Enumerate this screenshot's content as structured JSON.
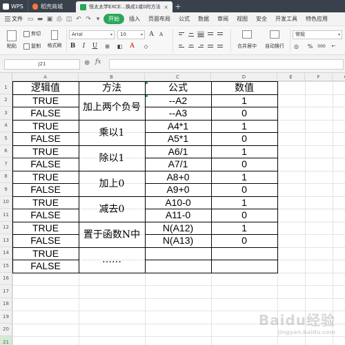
{
  "titlebar": {
    "app_name": "WPS",
    "store_tab": "稻壳商城",
    "doc_tab": "怪太太学EXCE...换成1或0的方法",
    "close": "×",
    "new_tab": "+"
  },
  "menubar": {
    "file_label": "文件",
    "items": [
      "开始",
      "插入",
      "页面布局",
      "公式",
      "数据",
      "审阅",
      "视图",
      "安全",
      "开发工具",
      "特色应用"
    ],
    "active_index": 0
  },
  "ribbon": {
    "paste": "粘贴",
    "cut": "剪切",
    "copy": "复制",
    "format_painter": "格式刷",
    "font_name": "Arial",
    "font_size": "10",
    "merge_center": "合并居中",
    "wrap": "自动换行",
    "number_format": "常规",
    "percent": "%",
    "thousands": "000",
    "bold": "B",
    "italic": "I",
    "underline": "U",
    "font_color": "A"
  },
  "formula_bar": {
    "name_box": "J21",
    "fx": "fx",
    "formula": ""
  },
  "grid": {
    "columns": [
      "A",
      "B",
      "C",
      "D",
      "E",
      "F",
      "G"
    ],
    "rows": [
      "1",
      "2",
      "3",
      "4",
      "5",
      "6",
      "7",
      "8",
      "9",
      "10",
      "11",
      "12",
      "13",
      "14",
      "15",
      "16",
      "17",
      "18",
      "19",
      "20",
      "21"
    ],
    "active_row": "21"
  },
  "table": {
    "headers": [
      "逻辑值",
      "方法",
      "公式",
      "数值"
    ],
    "logic_values": [
      "TRUE",
      "FALSE",
      "TRUE",
      "FALSE",
      "TRUE",
      "FALSE",
      "TRUE",
      "FALSE",
      "TRUE",
      "FALSE",
      "TRUE",
      "FALSE",
      "TRUE",
      "FALSE"
    ],
    "methods": [
      "加上两个负号",
      "乘以1",
      "除以1",
      "加上0",
      "减去0",
      "置于函数N中",
      "……"
    ],
    "formulas": [
      "--A2",
      "--A3",
      "A4*1",
      "A5*1",
      "A6/1",
      "A7/1",
      "A8+0",
      "A9+0",
      "A10-0",
      "A11-0",
      "N(A12)",
      "N(A13)",
      "",
      ""
    ],
    "results": [
      "1",
      "0",
      "1",
      "0",
      "1",
      "0",
      "1",
      "0",
      "1",
      "0",
      "1",
      "0",
      "",
      ""
    ]
  },
  "watermark": {
    "text": "Baidu经验",
    "sub": "jingyan.baidu.com"
  }
}
